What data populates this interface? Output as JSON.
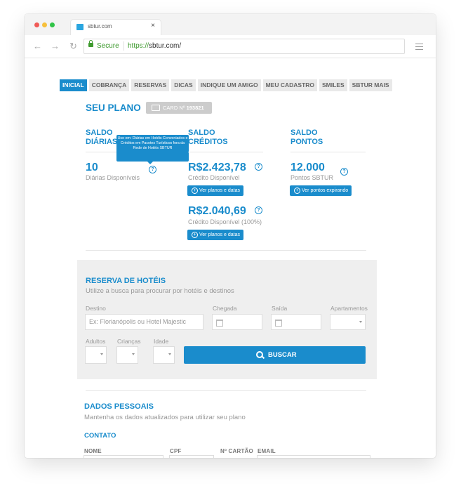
{
  "browser": {
    "tab_title": "sbtur.com",
    "close_glyph": "×",
    "secure_label": "Secure",
    "url_scheme": "https://",
    "url_host": "sbtur.com/",
    "traffic_colors": [
      "#f05a56",
      "#f7c03b",
      "#31c448"
    ]
  },
  "nav": {
    "items": [
      "INICIAL",
      "COBRANÇA",
      "RESERVAS",
      "DICAS",
      "INDIQUE UM AMIGO",
      "MEU CADASTRO",
      "SMILES",
      "SBTUR MAIS"
    ],
    "active": "INICIAL"
  },
  "plan": {
    "title": "SEU PLANO",
    "card_label": "CARD Nº",
    "card_number": "193821",
    "saldo_diarias": {
      "heading_line1": "SALDO",
      "heading_line2": "DIÁRIAS",
      "value": "10",
      "caption": "Diárias Disponíveis"
    },
    "saldo_creditos": {
      "heading_line1": "SALDO",
      "heading_line2": "CRÉDITOS",
      "value1": "R$2.423,78",
      "caption1": "Crédito Disponível",
      "button1": "Ver planos e datas",
      "value2": "R$2.040,69",
      "caption2": "Crédito Disponível (100%)",
      "button2": "Ver planos e datas"
    },
    "saldo_pontos": {
      "heading_line1": "SALDO",
      "heading_line2": "PONTOS",
      "value": "12.000",
      "caption": "Pontos SBTUR",
      "button": "Ver pontos expirando"
    },
    "tooltip": "Uso em: Diárias em Hotéis Conveniados e Créditos em Pacotes Turísticos fora da Rede de Hotéis SBTUR",
    "help_glyph": "?"
  },
  "hotel_search": {
    "title": "RESERVA DE HOTÉIS",
    "subtitle": "Utilize a busca para procurar por hotéis e destinos",
    "destino_label": "Destino",
    "destino_placeholder": "Ex: Florianópolis ou Hotel Majestic",
    "chegada_label": "Chegada",
    "saida_label": "Saída",
    "apartamentos_label": "Apartamentos",
    "adultos_label": "Adultos",
    "criancas_label": "Crianças",
    "idade_label": "Idade",
    "button": "BUSCAR"
  },
  "personal": {
    "title": "DADOS PESSOAIS",
    "subtitle": "Mantenha os dados atualizados para utilizar seu plano",
    "contato": "CONTATO",
    "col_nome": "NOME",
    "col_cpf": "CPF",
    "col_cartao": "Nº CARTÃO",
    "col_email": "EMAIL"
  }
}
